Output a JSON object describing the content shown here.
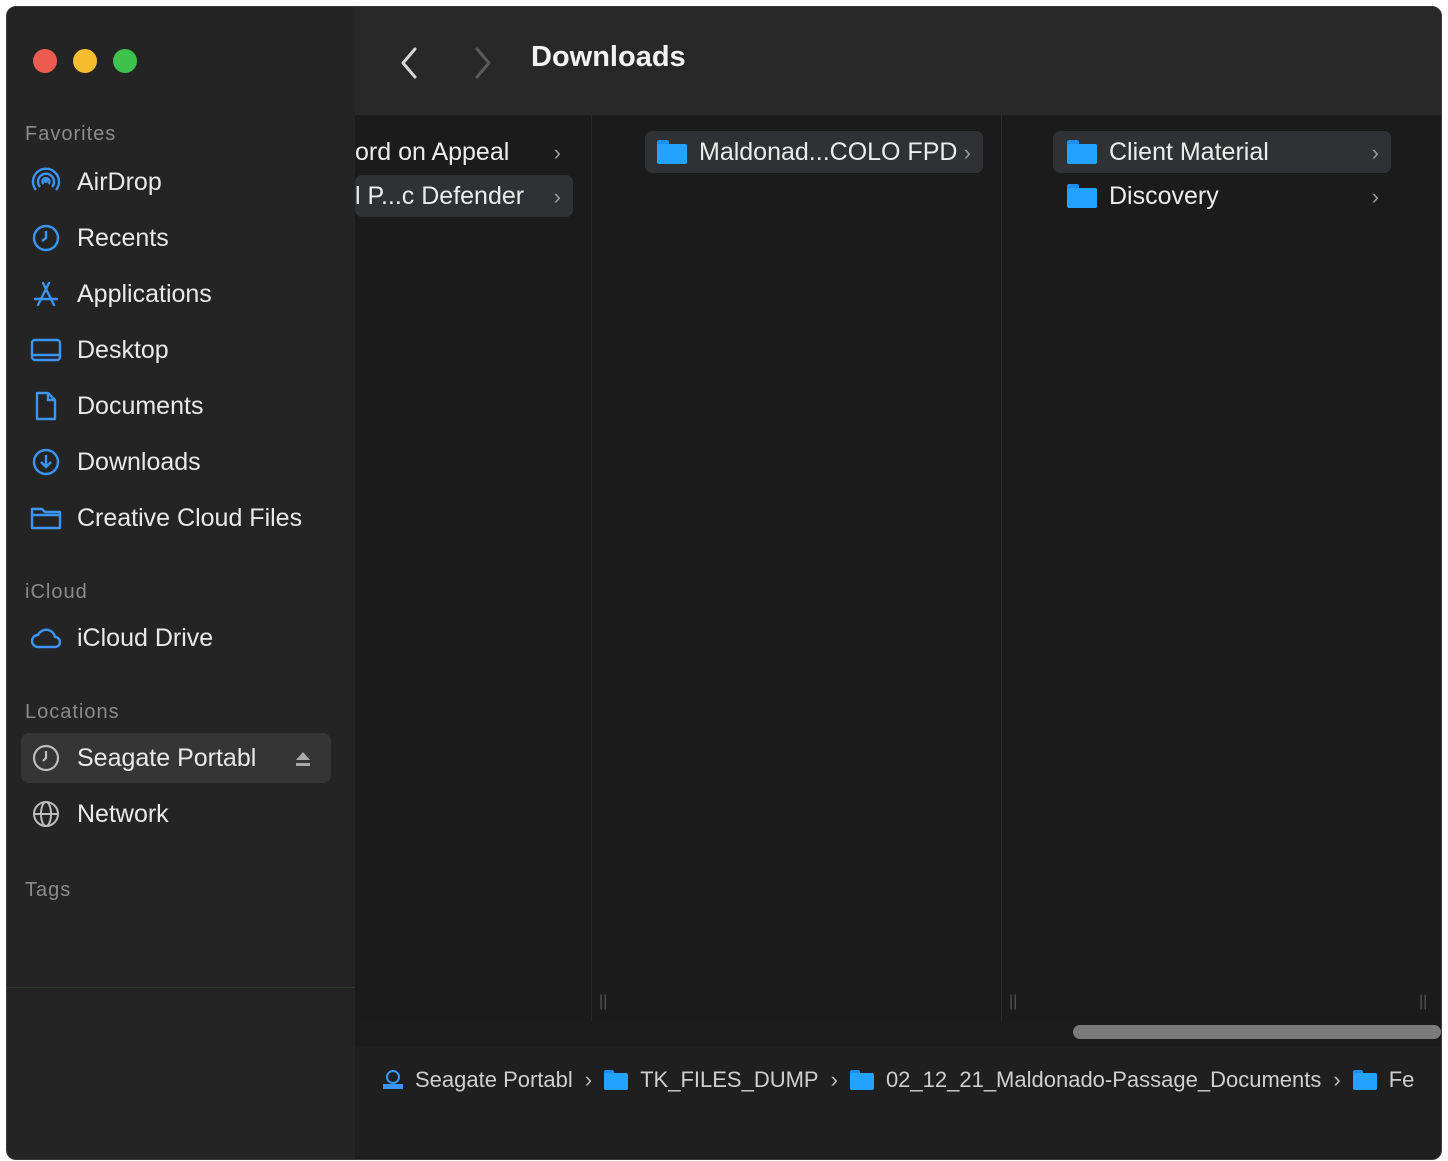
{
  "window": {
    "title": "Downloads"
  },
  "sidebar": {
    "sections": {
      "favorites": "Favorites",
      "icloud": "iCloud",
      "locations": "Locations",
      "tags": "Tags"
    },
    "favorites": [
      {
        "label": "AirDrop",
        "icon": "airdrop-icon"
      },
      {
        "label": "Recents",
        "icon": "clock-icon"
      },
      {
        "label": "Applications",
        "icon": "applications-icon"
      },
      {
        "label": "Desktop",
        "icon": "desktop-icon"
      },
      {
        "label": "Documents",
        "icon": "document-icon"
      },
      {
        "label": "Downloads",
        "icon": "download-icon"
      },
      {
        "label": "Creative Cloud Files",
        "icon": "folder-icon"
      }
    ],
    "icloud": [
      {
        "label": "iCloud Drive",
        "icon": "cloud-icon"
      }
    ],
    "locations": [
      {
        "label": "Seagate Portabl",
        "icon": "drive-icon",
        "selected": true
      },
      {
        "label": "Network",
        "icon": "network-icon"
      }
    ]
  },
  "columns": [
    {
      "items": [
        {
          "label": "ord on Appeal"
        },
        {
          "label": "l P...c Defender",
          "selected": true
        }
      ]
    },
    {
      "items": [
        {
          "label": "Maldonad...COLO FPD",
          "selected": true
        }
      ]
    },
    {
      "items": [
        {
          "label": "Client Material",
          "selected": true
        },
        {
          "label": "Discovery"
        }
      ]
    }
  ],
  "pathbar": {
    "segments": [
      "Seagate Portabl",
      "TK_FILES_DUMP",
      "02_12_21_Maldonado-Passage_Documents",
      "Fe"
    ]
  },
  "colors": {
    "accent_blue": "#23a3ff",
    "close": "#ee5b50",
    "minimize": "#f6be2f",
    "zoom": "#3fc24b"
  }
}
